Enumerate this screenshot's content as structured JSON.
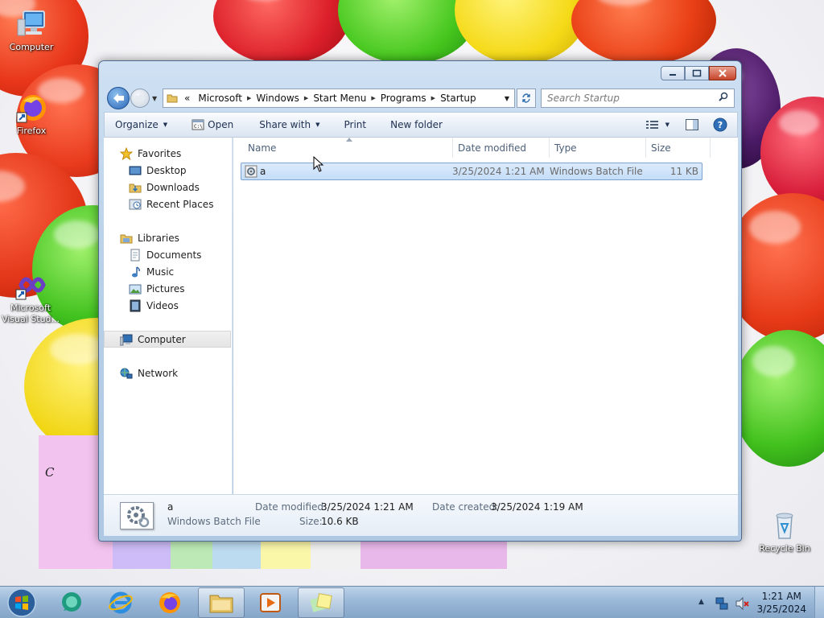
{
  "desktop": {
    "icons": [
      {
        "label": "Computer"
      },
      {
        "label": "Firefox"
      },
      {
        "label": "Microsoft Visual Stud..."
      },
      {
        "label": "Recycle Bin"
      }
    ],
    "sticky_note_text": "C"
  },
  "window": {
    "breadcrumb": [
      "Microsoft",
      "Windows",
      "Start Menu",
      "Programs",
      "Startup"
    ],
    "breadcrumb_overflow": "«",
    "search_placeholder": "Search Startup",
    "commands": {
      "organize": "Organize",
      "open": "Open",
      "share_with": "Share with",
      "print": "Print",
      "new_folder": "New folder"
    },
    "nav": {
      "favorites": "Favorites",
      "desktop": "Desktop",
      "downloads": "Downloads",
      "recent_places": "Recent Places",
      "libraries": "Libraries",
      "documents": "Documents",
      "music": "Music",
      "pictures": "Pictures",
      "videos": "Videos",
      "computer": "Computer",
      "network": "Network"
    },
    "columns": {
      "name": "Name",
      "date_modified": "Date modified",
      "type": "Type",
      "size": "Size"
    },
    "files": [
      {
        "name": "a",
        "date_modified": "3/25/2024 1:21 AM",
        "type": "Windows Batch File",
        "size": "11 KB"
      }
    ],
    "details": {
      "name": "a",
      "type": "Windows Batch File",
      "date_modified_label": "Date modified:",
      "date_modified": "3/25/2024 1:21 AM",
      "date_created_label": "Date created:",
      "date_created": "3/25/2024 1:19 AM",
      "size_label": "Size:",
      "size": "10.6 KB"
    }
  },
  "taskbar": {
    "time": "1:21 AM",
    "date": "3/25/2024"
  }
}
